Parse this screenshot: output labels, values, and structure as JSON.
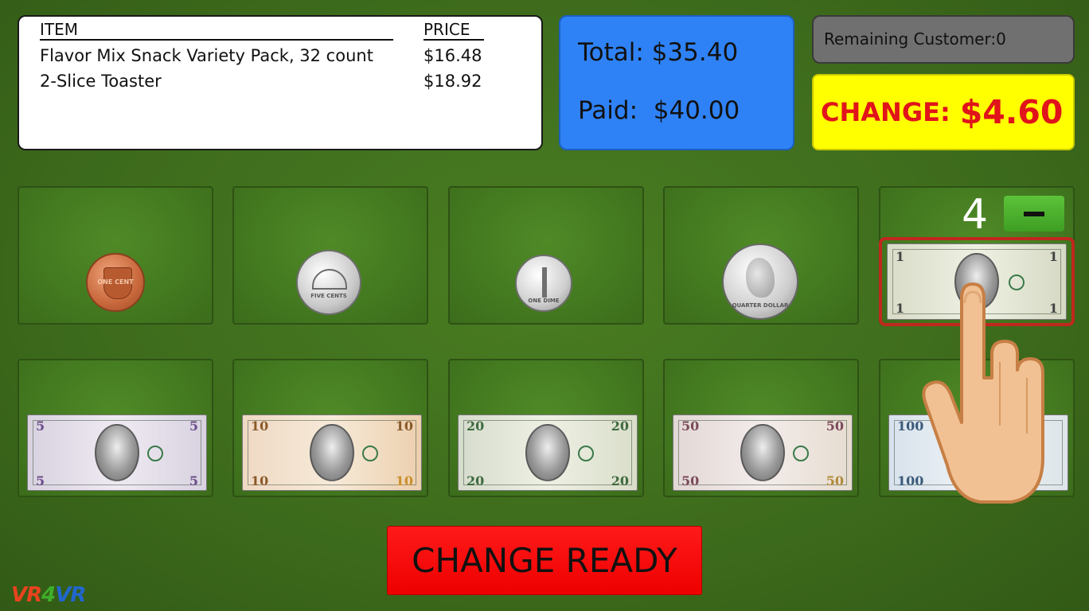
{
  "receipt": {
    "col_item": "ITEM",
    "col_price": "PRICE",
    "items": [
      {
        "name": "Flavor Mix Snack Variety Pack, 32 count",
        "price": "$16.48"
      },
      {
        "name": "2-Slice Toaster",
        "price": "$18.92"
      }
    ]
  },
  "totals": {
    "total_label": "Total:",
    "total_value": "$35.40",
    "paid_label": "Paid:",
    "paid_value": "$40.00"
  },
  "remaining": "Remaining Customer:0",
  "change": {
    "label": "CHANGE:",
    "value": "$4.60"
  },
  "one_dollar_count": "4",
  "change_ready_label": "CHANGE READY",
  "logo": {
    "part1": "VR",
    "part2": "4",
    "part3": "VR"
  },
  "coins": {
    "penny": "ONE CENT",
    "nickel": "FIVE CENTS",
    "dime": "ONE DIME",
    "quarter": "QUARTER DOLLAR"
  },
  "colors": {
    "table": "#3d6b1c",
    "totals_bg": "#2f82f5",
    "change_bg": "#ffff00",
    "change_text": "#e0141a",
    "button": "#ff0000"
  }
}
